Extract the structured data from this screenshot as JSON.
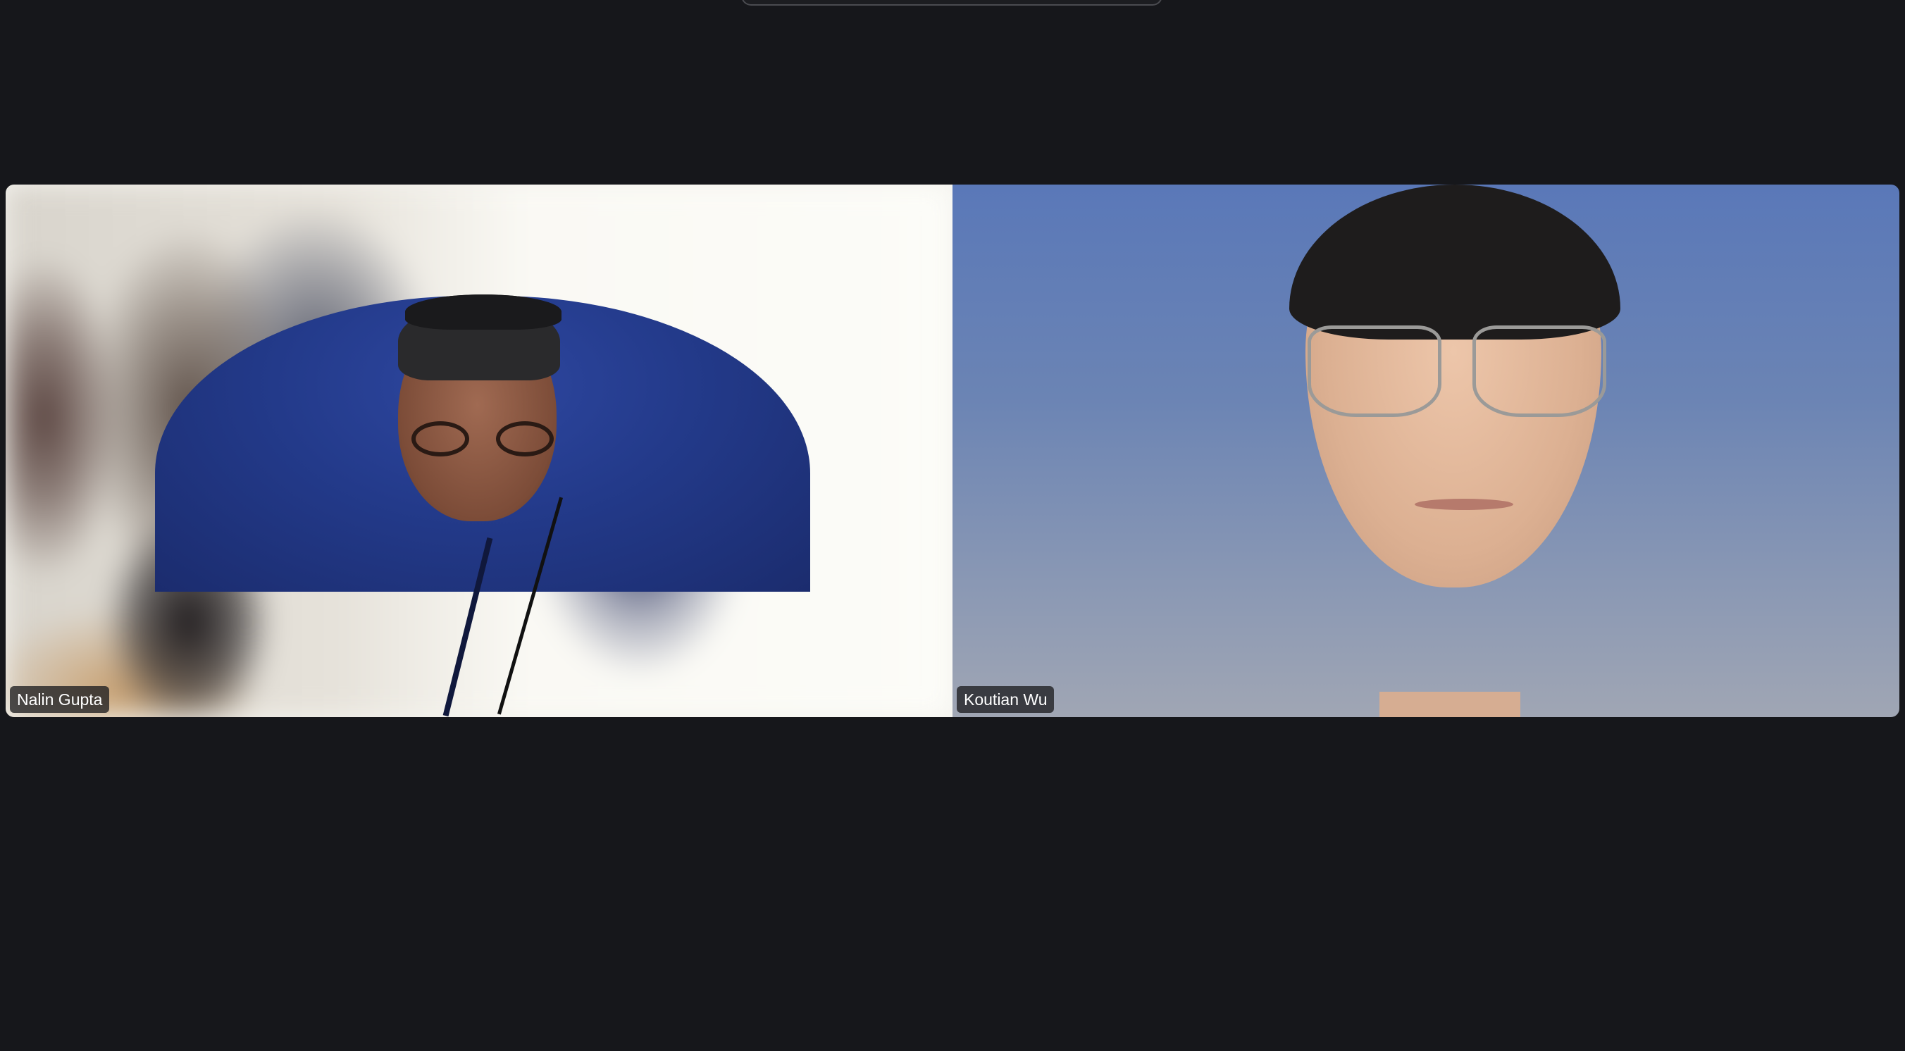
{
  "participants": [
    {
      "name": "Nalin Gupta"
    },
    {
      "name": "Koutian Wu"
    }
  ],
  "colors": {
    "background": "#16171b",
    "label_bg": "#1e1e20",
    "label_text": "#ffffff"
  }
}
